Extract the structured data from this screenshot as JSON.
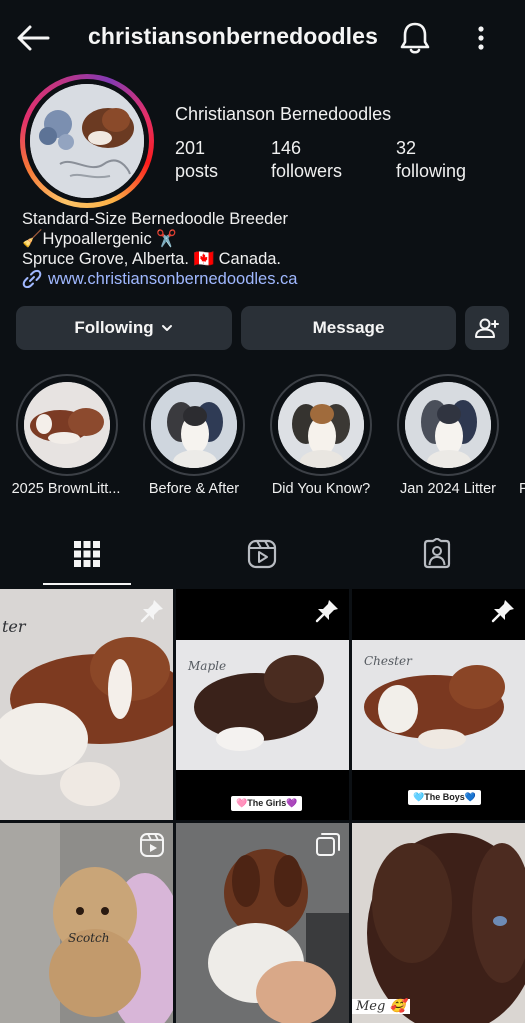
{
  "header": {
    "username": "christiansonbernedoodles",
    "back_icon": "arrow-left-icon",
    "bell_icon": "bell-icon",
    "more_icon": "more-vertical-icon"
  },
  "profile": {
    "display_name": "Christianson Bernedoodles",
    "stats": [
      {
        "value": "201",
        "label": "posts"
      },
      {
        "value": "146",
        "label": "followers"
      },
      {
        "value": "32",
        "label": "following"
      }
    ],
    "bio_lines": [
      "Standard-Size Bernedoodle Breeder",
      "🧹Hypoallergenic ✂️",
      "Spruce Grove, Alberta. 🇨🇦  Canada."
    ],
    "link": "www.christiansonbernedoodles.ca"
  },
  "actions": {
    "following_label": "Following",
    "message_label": "Message"
  },
  "highlights": [
    {
      "label": "2025 BrownLitt..."
    },
    {
      "label": "Before & After"
    },
    {
      "label": "Did You Know?"
    },
    {
      "label": "Jan 2024 Litter"
    },
    {
      "label": "P"
    }
  ],
  "tabs": [
    {
      "name": "grid"
    },
    {
      "name": "reels"
    },
    {
      "name": "tagged"
    }
  ],
  "posts": [
    {
      "caption": "ter",
      "pinned": true
    },
    {
      "caption": "Maple",
      "tag": "🩷The Girls💜",
      "pinned": true
    },
    {
      "caption": "Chester",
      "tag": "🩵The Boys💙",
      "pinned": true
    },
    {
      "caption": "Scotch",
      "type": "reel"
    },
    {
      "caption": "",
      "type": "carousel"
    },
    {
      "caption": "Meg 🥰"
    }
  ],
  "colors": {
    "background": "#0c1014",
    "button": "#2a3037",
    "link": "#a0b8ff"
  }
}
